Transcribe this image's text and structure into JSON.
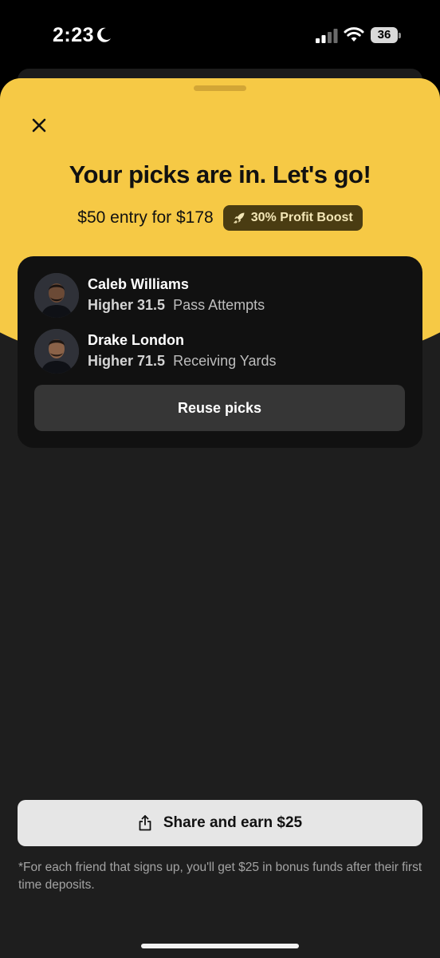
{
  "status_bar": {
    "time": "2:23",
    "battery": "36"
  },
  "sheet": {
    "headline": "Your picks are in. Let's go!",
    "entry_text": "$50 entry for $178",
    "boost_label": "30% Profit Boost",
    "accent_color": "#f6c945"
  },
  "picks": [
    {
      "name": "Caleb Williams",
      "direction": "Higher",
      "value": "31.5",
      "stat": "Pass Attempts"
    },
    {
      "name": "Drake London",
      "direction": "Higher",
      "value": "71.5",
      "stat": "Receiving Yards"
    }
  ],
  "reuse_label": "Reuse picks",
  "share_label": "Share and earn $25",
  "footnote": "*For each friend that signs up, you'll get $25 in bonus funds after their first time deposits.",
  "icons": {
    "close": "close-icon",
    "boost": "rocket-icon",
    "share": "share-icon",
    "moon": "moon-icon",
    "signal": "cellular-signal-icon",
    "wifi": "wifi-icon"
  }
}
